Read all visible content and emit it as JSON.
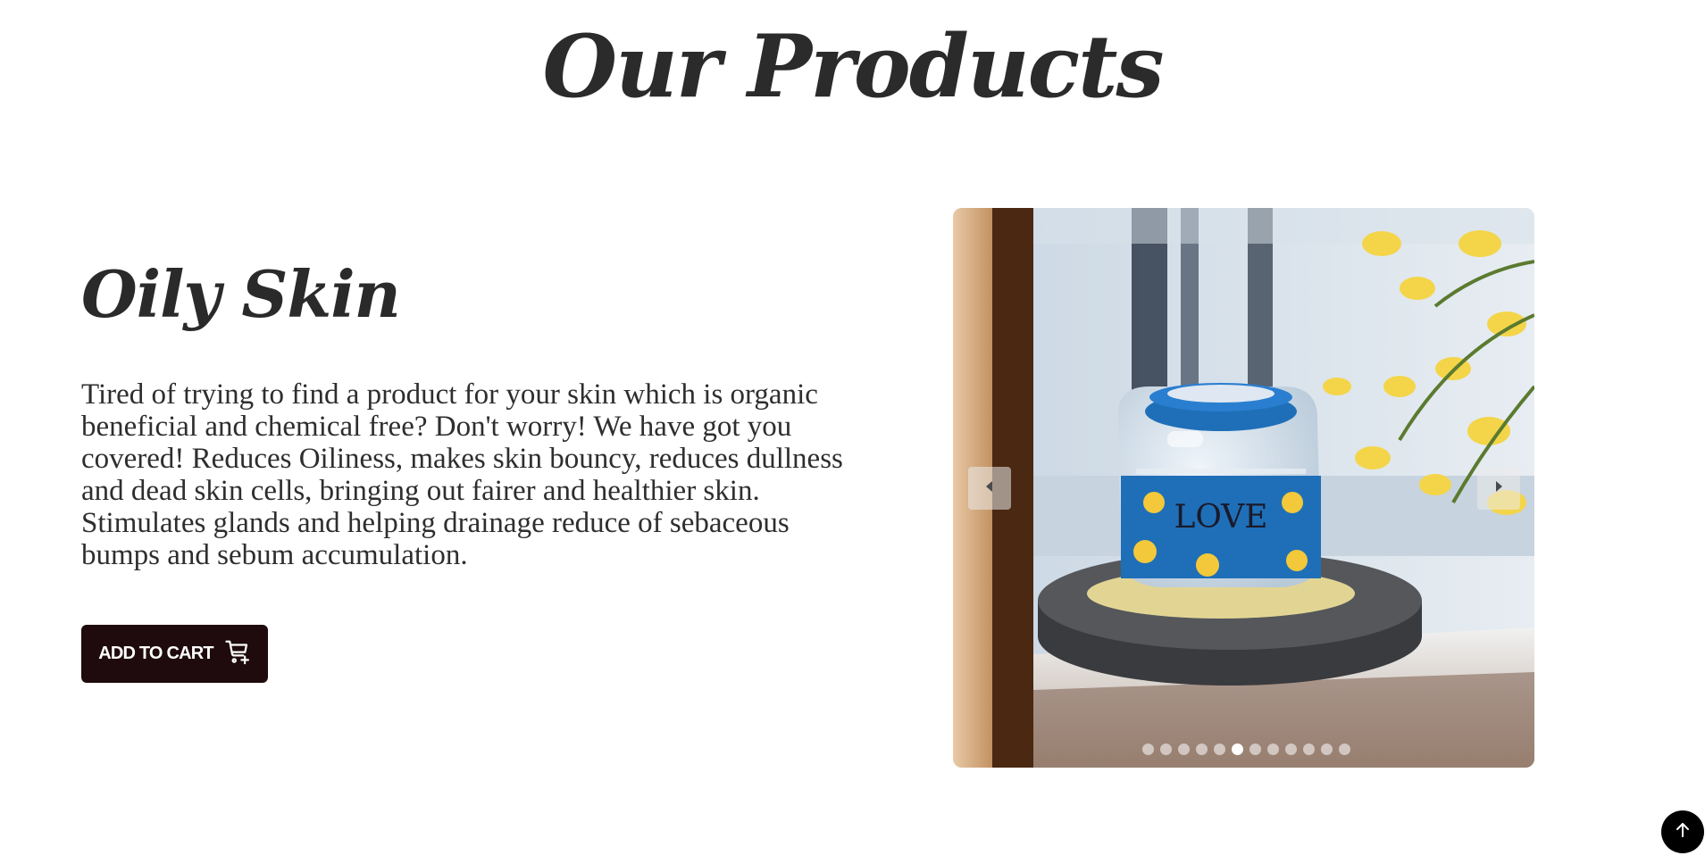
{
  "section": {
    "heading": "Our Products"
  },
  "product": {
    "name": "Oily Skin",
    "description": "Tired of trying to find a product for your skin which is organic beneficial and chemical free? Don't worry! We have got you covered! Reduces Oiliness, makes skin bouncy, reduces dullness and dead skin cells, bringing out fairer and healthier skin. Stimulates glands and helping drainage reduce of sebaceous bumps and sebum accumulation.",
    "add_to_cart_label": "ADD TO CART",
    "add_to_cart_icon": "cart-plus-icon"
  },
  "carousel": {
    "slide_count": 12,
    "active_index": 5,
    "prev_icon": "caret-left-icon",
    "next_icon": "caret-right-icon",
    "jar_label": "LOVE"
  },
  "scroll_top": {
    "icon": "arrow-up-icon"
  },
  "colors": {
    "button_bg": "#1f0a0d",
    "heading": "#2b2b2b",
    "scroll_top_bg": "#000000"
  }
}
